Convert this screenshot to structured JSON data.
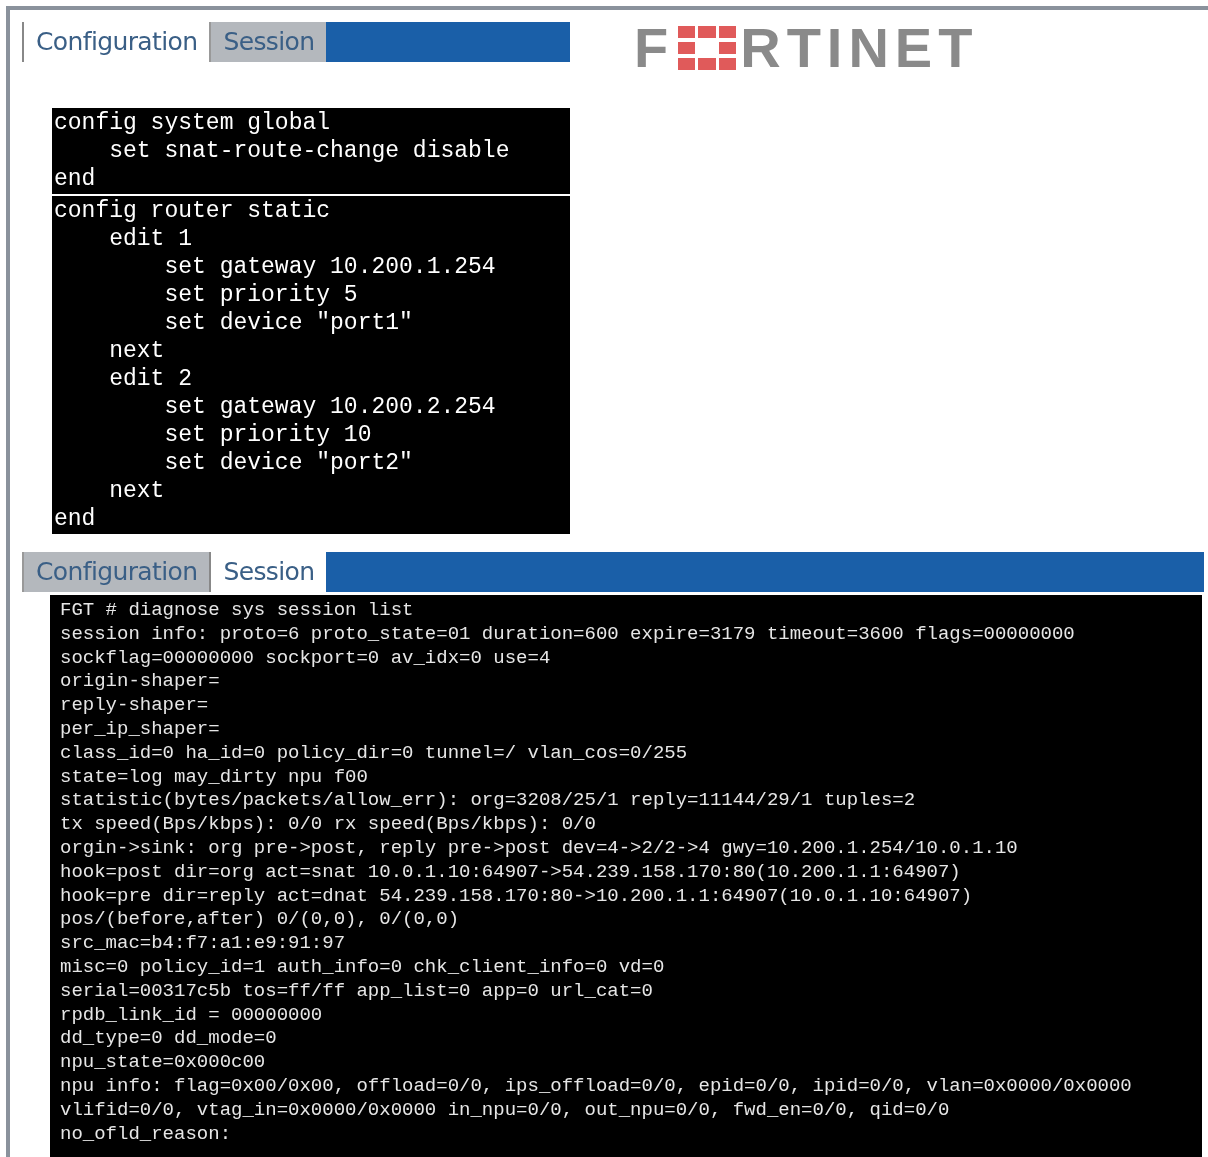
{
  "logo": {
    "parts": [
      "F",
      "RTINET"
    ]
  },
  "panels": [
    {
      "tabs": [
        {
          "label": "Configuration",
          "selected": true
        },
        {
          "label": "Session",
          "selected": false
        }
      ],
      "kind": "config",
      "blocks": [
        [
          "config system global",
          "    set snat-route-change disable",
          "end"
        ],
        [
          "config router static",
          "    edit 1",
          "        set gateway 10.200.1.254",
          "        set priority 5",
          "        set device \"port1\"",
          "    next",
          "    edit 2",
          "        set gateway 10.200.2.254",
          "        set priority 10",
          "        set device \"port2\"",
          "    next",
          "end"
        ]
      ]
    },
    {
      "tabs": [
        {
          "label": "Configuration",
          "selected": false
        },
        {
          "label": "Session",
          "selected": true
        }
      ],
      "kind": "session",
      "blocks": [
        [
          "FGT # diagnose sys session list",
          "session info: proto=6 proto_state=01 duration=600 expire=3179 timeout=3600 flags=00000000",
          "sockflag=00000000 sockport=0 av_idx=0 use=4",
          "origin-shaper=",
          "reply-shaper=",
          "per_ip_shaper=",
          "class_id=0 ha_id=0 policy_dir=0 tunnel=/ vlan_cos=0/255",
          "state=log may_dirty npu f00",
          "statistic(bytes/packets/allow_err): org=3208/25/1 reply=11144/29/1 tuples=2",
          "tx speed(Bps/kbps): 0/0 rx speed(Bps/kbps): 0/0",
          "orgin->sink: org pre->post, reply pre->post dev=4->2/2->4 gwy=10.200.1.254/10.0.1.10",
          "hook=post dir=org act=snat 10.0.1.10:64907->54.239.158.170:80(10.200.1.1:64907)",
          "hook=pre dir=reply act=dnat 54.239.158.170:80->10.200.1.1:64907(10.0.1.10:64907)",
          "pos/(before,after) 0/(0,0), 0/(0,0)",
          "src_mac=b4:f7:a1:e9:91:97",
          "misc=0 policy_id=1 auth_info=0 chk_client_info=0 vd=0",
          "serial=00317c5b tos=ff/ff app_list=0 app=0 url_cat=0",
          "rpdb_link_id = 00000000",
          "dd_type=0 dd_mode=0",
          "npu_state=0x000c00",
          "npu info: flag=0x00/0x00, offload=0/0, ips_offload=0/0, epid=0/0, ipid=0/0, vlan=0x0000/0x0000",
          "vlifid=0/0, vtag_in=0x0000/0x0000 in_npu=0/0, out_npu=0/0, fwd_en=0/0, qid=0/0",
          "no_ofld_reason:"
        ]
      ]
    }
  ]
}
